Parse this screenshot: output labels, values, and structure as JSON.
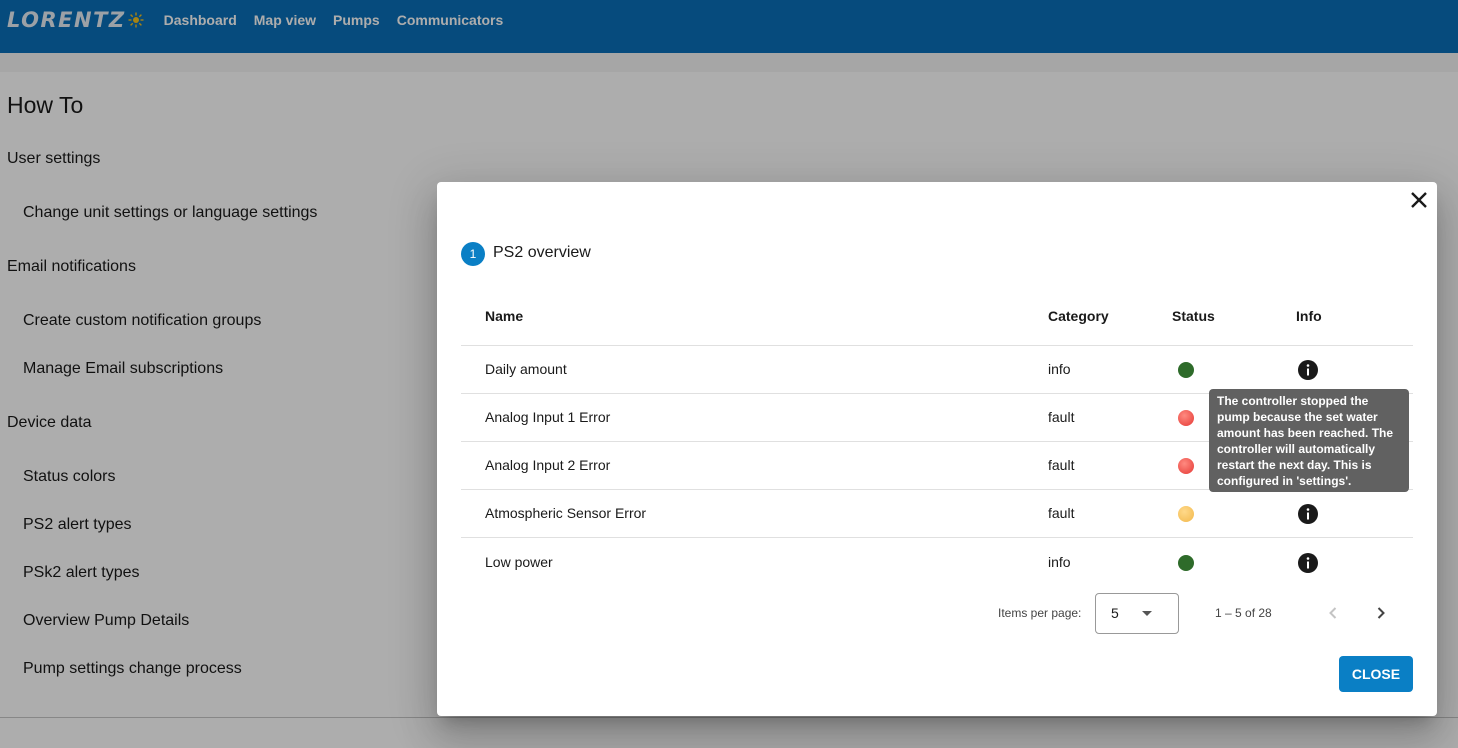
{
  "brand": {
    "name": "LORENTZ"
  },
  "nav": [
    "Dashboard",
    "Map view",
    "Pumps",
    "Communicators"
  ],
  "page": {
    "title": "How To",
    "sections": [
      {
        "title": "User settings",
        "items": [
          "Change unit settings or language settings"
        ]
      },
      {
        "title": "Email notifications",
        "items": [
          "Create custom notification groups",
          "Manage Email subscriptions"
        ]
      },
      {
        "title": "Device data",
        "items": [
          "Status colors",
          "PS2 alert types",
          "PSk2 alert types",
          "Overview Pump Details",
          "Pump settings change process"
        ]
      }
    ]
  },
  "dialog": {
    "step_number": "1",
    "step_title": "PS2 overview",
    "columns": [
      "Name",
      "Category",
      "Status",
      "Info"
    ],
    "rows": [
      {
        "name": "Daily amount",
        "category": "info",
        "status": "green"
      },
      {
        "name": "Analog Input 1 Error",
        "category": "fault",
        "status": "red"
      },
      {
        "name": "Analog Input 2 Error",
        "category": "fault",
        "status": "red"
      },
      {
        "name": "Atmospheric Sensor Error",
        "category": "fault",
        "status": "yellow"
      },
      {
        "name": "Low power",
        "category": "info",
        "status": "green"
      }
    ],
    "tooltip": "The controller stopped the pump because the set water amount has been reached. The controller will automatically restart the next day. This is configured in 'settings'.",
    "paginator": {
      "label": "Items per page:",
      "page_size": "5",
      "range": "1 – 5 of 28"
    },
    "close_label": "CLOSE"
  },
  "colors": {
    "header": "#0a6fb8",
    "accent": "#0a7fc5",
    "green": "#2e7d32",
    "red": "#e53935",
    "yellow": "#f2b84b",
    "tooltip": "#616161"
  },
  "icons": [
    "sun-logo-icon",
    "close-icon",
    "info-icon",
    "chevron-left-icon",
    "chevron-right-icon",
    "dropdown-arrow-icon"
  ]
}
